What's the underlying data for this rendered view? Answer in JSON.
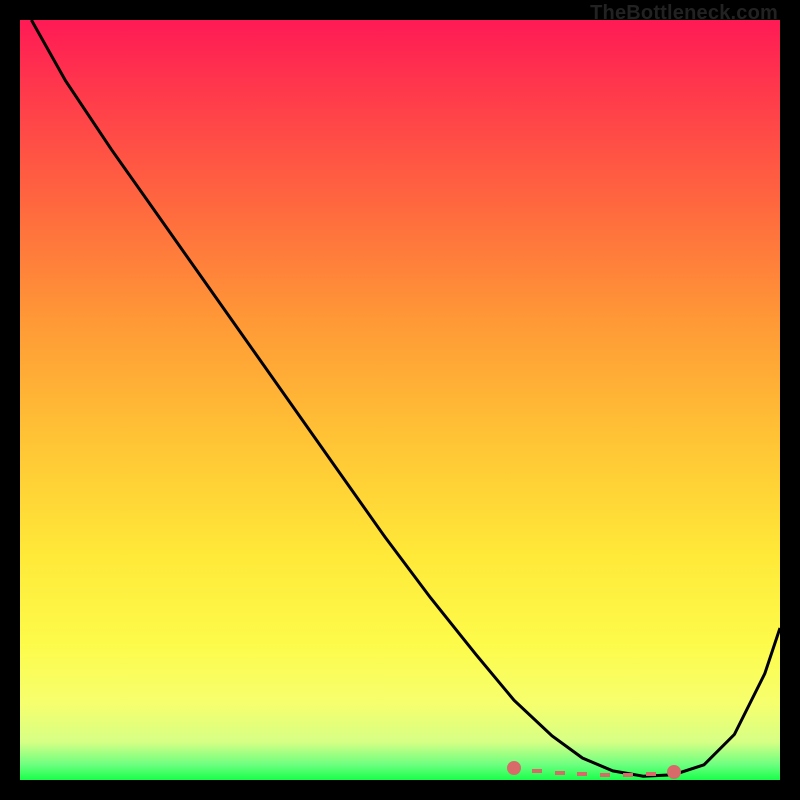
{
  "watermark": "TheBottleneck.com",
  "colors": {
    "background": "#000000",
    "gradient_top": "#ff1a55",
    "gradient_bottom": "#18ff4a",
    "curve": "#000000",
    "dot": "#d96a6a"
  },
  "chart_data": {
    "type": "line",
    "title": "",
    "xlabel": "",
    "ylabel": "",
    "xlim": [
      0,
      100
    ],
    "ylim": [
      0,
      100
    ],
    "series": [
      {
        "name": "bottleneck-curve",
        "x": [
          1.5,
          6,
          12,
          18,
          24,
          30,
          36,
          42,
          48,
          54,
          60,
          65,
          70,
          74,
          78,
          82,
          86,
          90,
          94,
          98,
          100
        ],
        "y": [
          100,
          92,
          83,
          74.5,
          66,
          57.5,
          49,
          40.5,
          32,
          24,
          16.5,
          10.5,
          5.8,
          2.9,
          1.2,
          0.5,
          0.7,
          2,
          6,
          14,
          20
        ]
      },
      {
        "name": "marker-dots",
        "x": [
          65,
          68,
          71,
          74,
          77,
          80,
          83,
          86
        ],
        "y": [
          1.6,
          1.2,
          0.9,
          0.8,
          0.7,
          0.7,
          0.8,
          1.1
        ]
      }
    ]
  }
}
